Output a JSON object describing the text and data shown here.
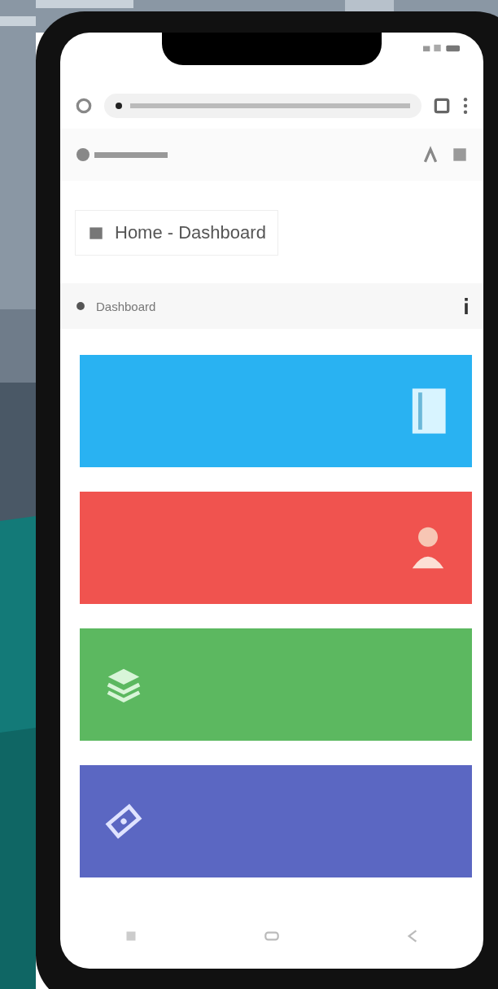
{
  "page": {
    "title": "Home - Dashboard"
  },
  "breadcrumb": {
    "label": "Dashboard"
  },
  "cards": [
    {
      "color": "#29b2f2"
    },
    {
      "color": "#f0534f"
    },
    {
      "color": "#5cb860"
    },
    {
      "color": "#5b67c2"
    }
  ]
}
